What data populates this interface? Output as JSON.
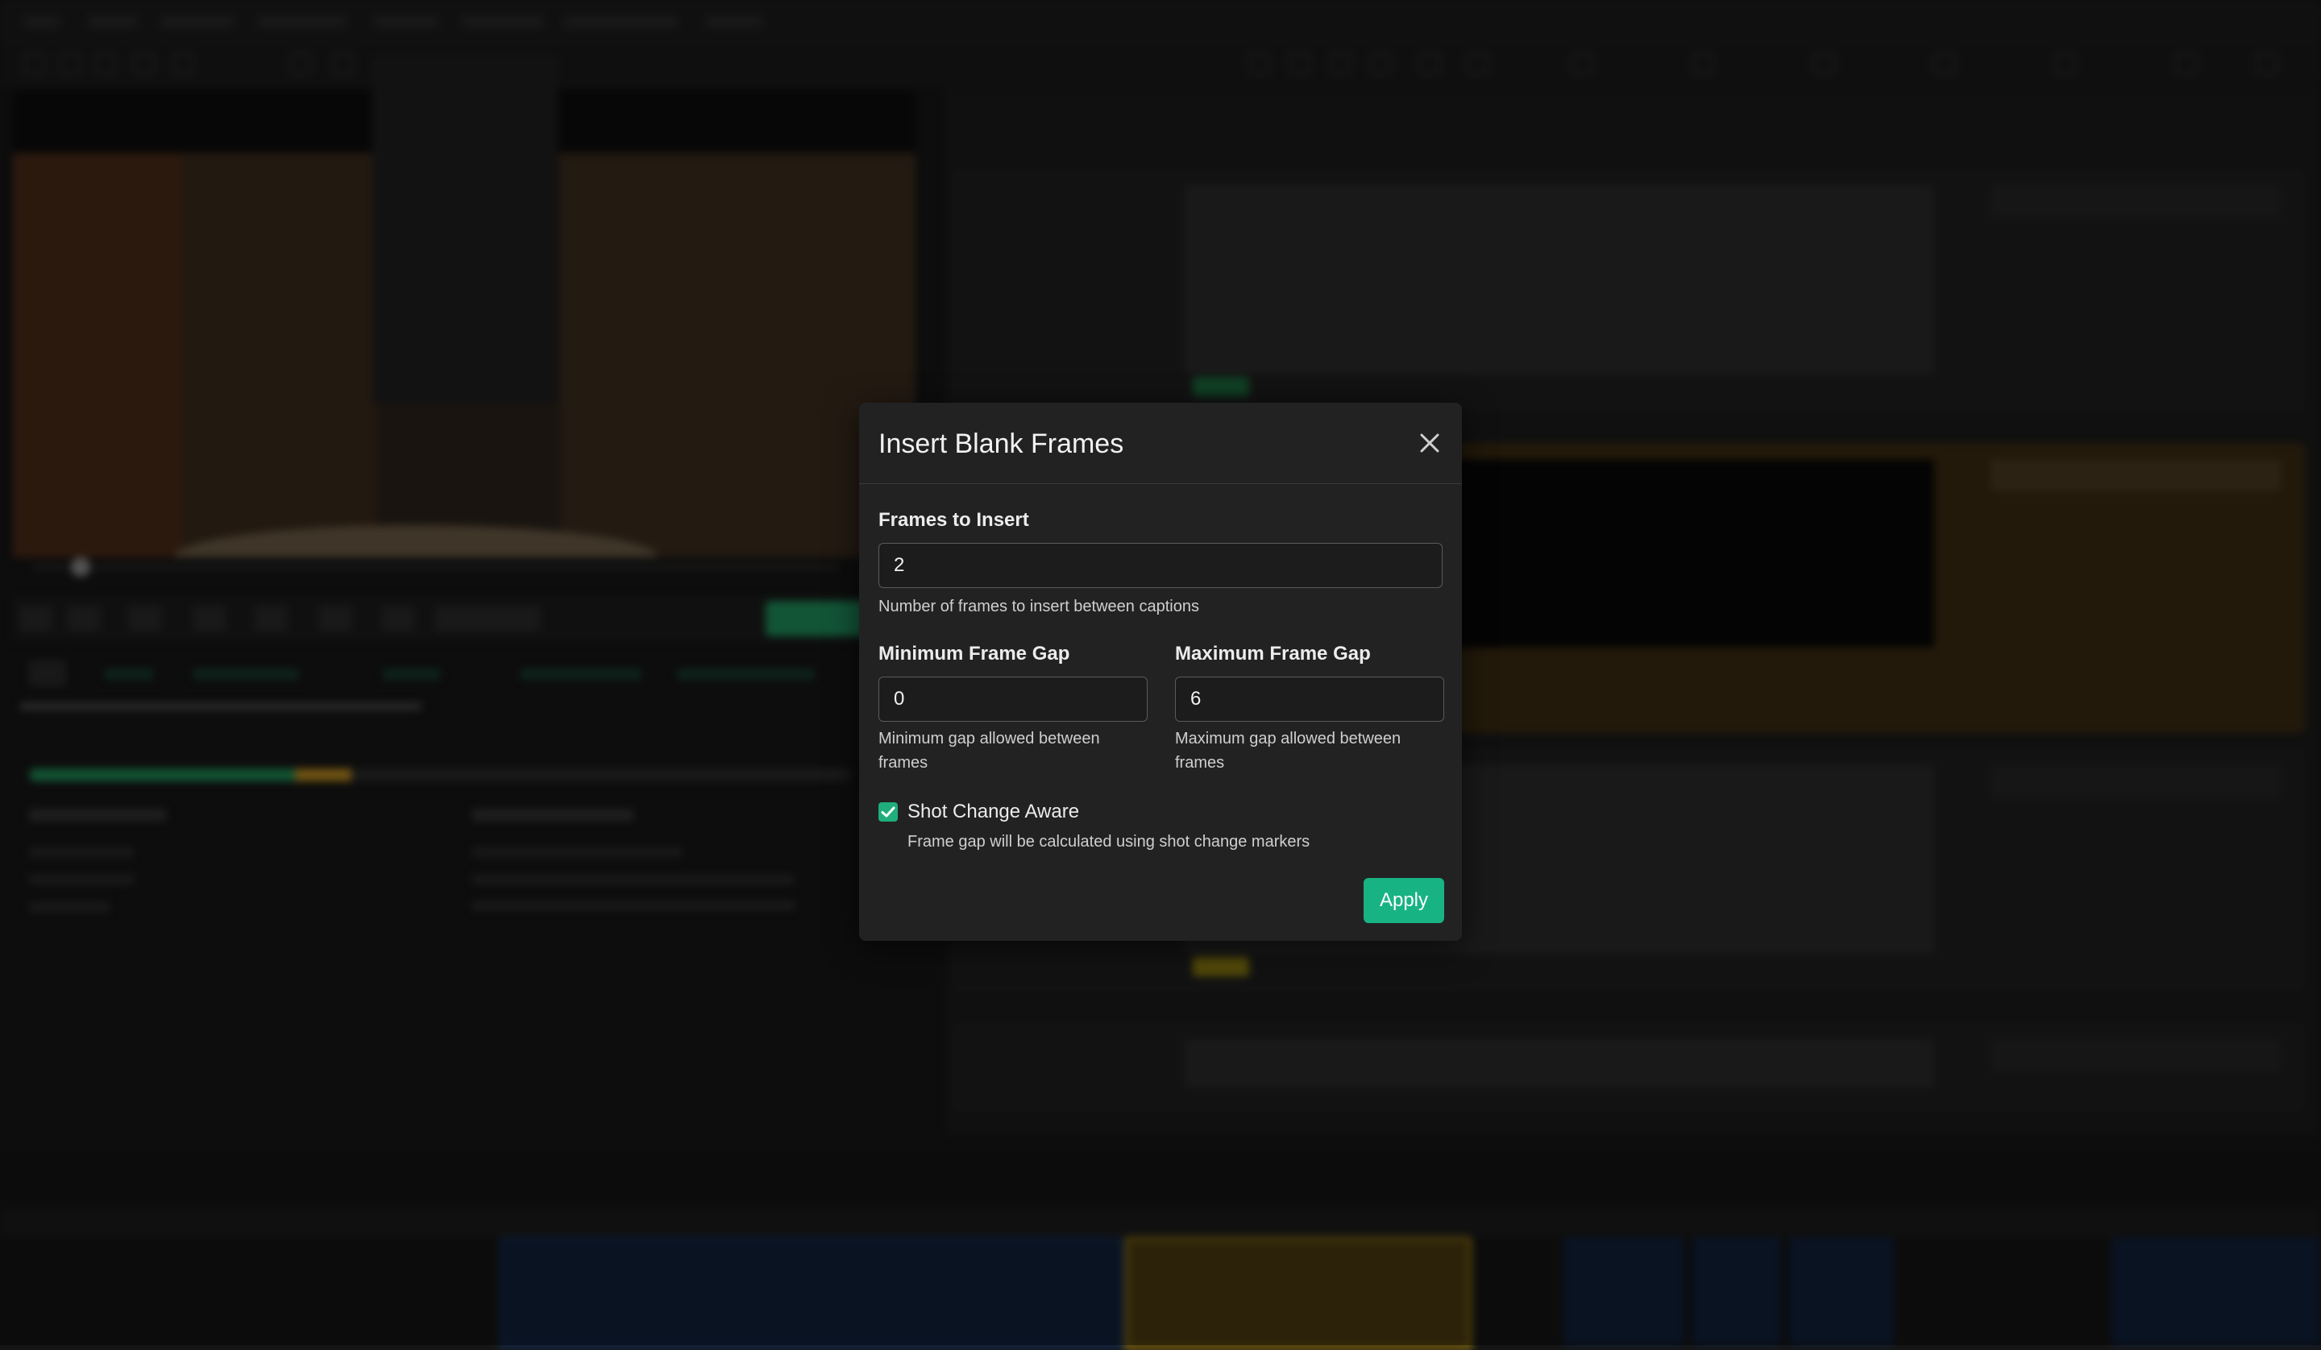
{
  "dialog": {
    "title": "Insert Blank Frames",
    "frames_to_insert": {
      "label": "Frames to Insert",
      "value": "2",
      "help": "Number of frames to insert between captions"
    },
    "min_frame_gap": {
      "label": "Minimum Frame Gap",
      "value": "0",
      "help": "Minimum gap allowed between frames"
    },
    "max_frame_gap": {
      "label": "Maximum Frame Gap",
      "value": "6",
      "help": "Maximum gap allowed between frames"
    },
    "shot_change_aware": {
      "label": "Shot Change Aware",
      "checked": true,
      "help": "Frame gap will be calculated using shot change markers"
    },
    "apply_label": "Apply"
  },
  "colors": {
    "accent": "#18b383",
    "dialog_bg": "#222222",
    "highlight_card": "#3a2a12"
  },
  "icons": {
    "close": "close-icon",
    "checkbox": "checkmark-icon"
  }
}
